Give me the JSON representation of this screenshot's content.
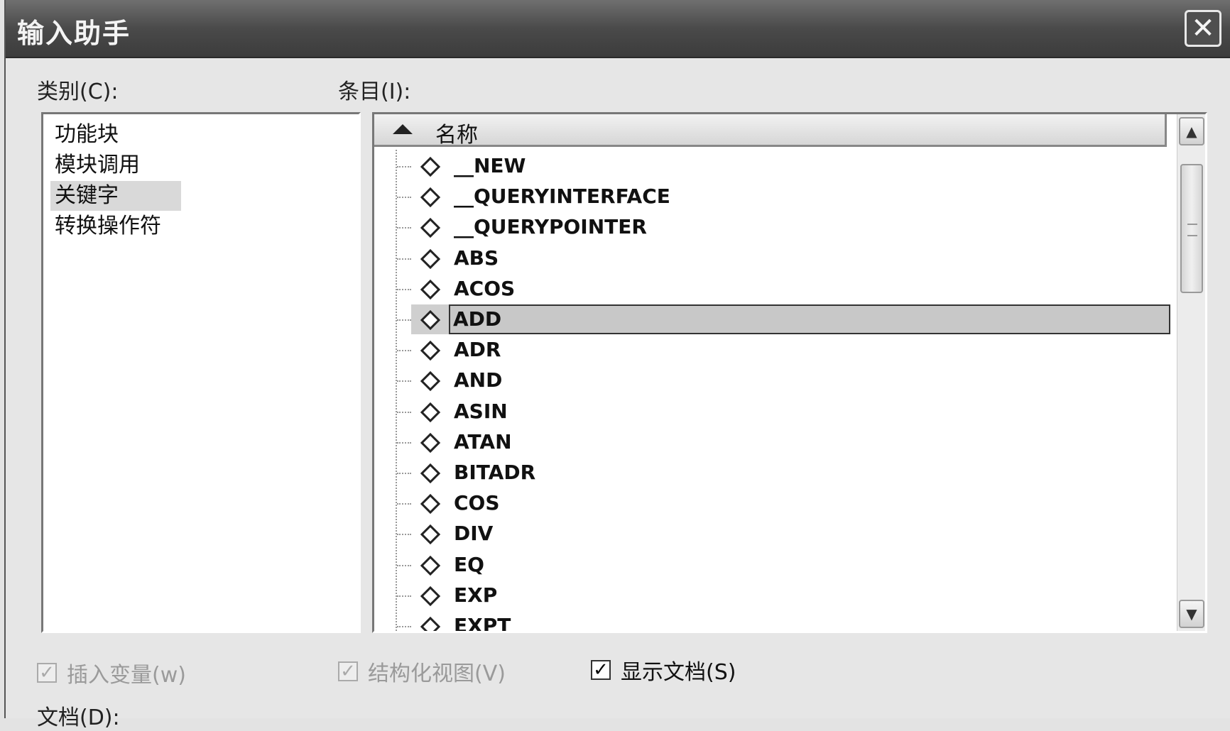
{
  "window": {
    "title": "输入助手"
  },
  "labels": {
    "category": "类别(C):",
    "items": "条目(I):",
    "doc": "文档(D):"
  },
  "categories": [
    "功能块",
    "模块调用",
    "关键字",
    "转换操作符"
  ],
  "selected_category": "关键字",
  "items_header": {
    "column": "名称",
    "sort": "ascending"
  },
  "items": [
    "__NEW",
    "__QUERYINTERFACE",
    "__QUERYPOINTER",
    "ABS",
    "ACOS",
    "ADD",
    "ADR",
    "AND",
    "ASIN",
    "ATAN",
    "BITADR",
    "COS",
    "DIV",
    "EQ",
    "EXP",
    "EXPT"
  ],
  "selected_item": "ADD",
  "checkboxes": {
    "insert_var": {
      "label": "插入变量(w)",
      "checked": true,
      "enabled": false
    },
    "structured_view": {
      "label": "结构化视图(V)",
      "checked": true,
      "enabled": false
    },
    "show_doc": {
      "label": "显示文档(S)",
      "checked": true,
      "enabled": true
    }
  },
  "icons": {
    "close": "close-icon",
    "item": "diamond-icon",
    "sort": "sort-ascending-icon",
    "scroll_up": "scroll-up-icon",
    "scroll_down": "scroll-down-icon",
    "check": "checkmark-icon"
  }
}
